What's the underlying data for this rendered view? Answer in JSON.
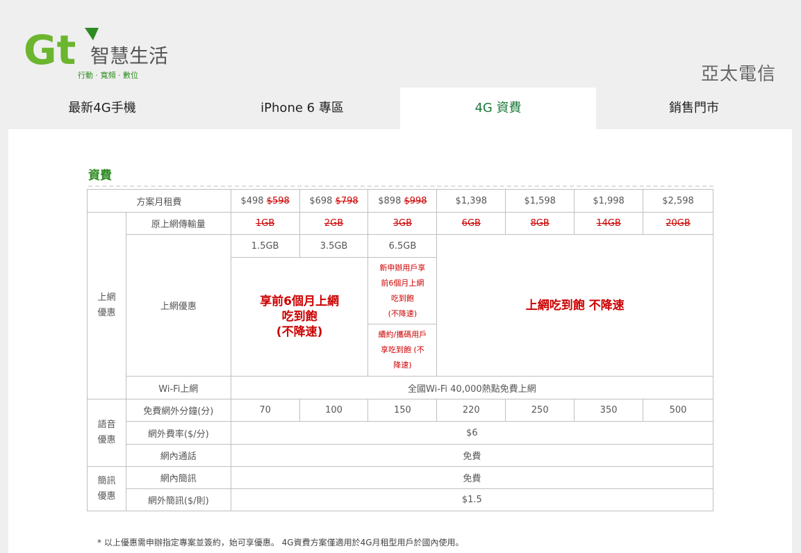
{
  "logo": {
    "mark": "Gt",
    "name": "智慧生活",
    "tagline": "行動 · 寬頻 · 數位"
  },
  "brand_right": "亞太電信",
  "colors": {
    "brand_green": "#6bb52f",
    "accent_green": "#2e8b22",
    "promo_red": "#cc0000"
  },
  "nav": [
    {
      "label": "最新4G手機"
    },
    {
      "label": "iPhone 6 專區"
    },
    {
      "label": "4G 資費",
      "active": true
    },
    {
      "label": "銷售門市"
    }
  ],
  "section_title": "資費",
  "table": {
    "row_monthly_label": "方案月租費",
    "prices": [
      {
        "price": "$498",
        "old": "$598"
      },
      {
        "price": "$698",
        "old": "$798"
      },
      {
        "price": "$898",
        "old": "$998"
      },
      {
        "price": "$1,398",
        "old": ""
      },
      {
        "price": "$1,598",
        "old": ""
      },
      {
        "price": "$1,998",
        "old": ""
      },
      {
        "price": "$2,598",
        "old": ""
      }
    ],
    "group_internet": "上網\n優惠",
    "row_orig_data_label": "原上網傳輸量",
    "orig_data": [
      "1GB",
      "2GB",
      "3GB",
      "6GB",
      "8GB",
      "14GB",
      "20GB"
    ],
    "row_internet_label": "上網優惠",
    "data_allowance": [
      "1.5GB",
      "3.5GB",
      "6.5GB"
    ],
    "promo_first6": "享前6個月上網\n吃到飽\n(不降速)",
    "promo_new_user": "新申辦用戶享\n前6個月上網\n吃到飽\n(不降速)",
    "promo_renew": "續約/攜碼用戶\n享吃到飽 (不\n降速)",
    "promo_unlimited": "上網吃到飽 不降速",
    "row_wifi_label": "Wi-Fi上網",
    "wifi_value": "全國Wi-Fi 40,000熱點免費上網",
    "group_voice": "語音\n優惠",
    "row_free_minutes_label": "免費網外分鐘(分)",
    "free_minutes": [
      "70",
      "100",
      "150",
      "220",
      "250",
      "350",
      "500"
    ],
    "row_offnet_rate_label": "網外費率($/分)",
    "offnet_rate": "$6",
    "row_onnet_call_label": "網內通話",
    "onnet_call": "免費",
    "group_sms": "簡訊\n優惠",
    "row_onnet_sms_label": "網內簡訊",
    "onnet_sms": "免費",
    "row_offnet_sms_label": "網外簡訊($/則)",
    "offnet_sms": "$1.5"
  },
  "footnote": "* 以上優惠需申辦指定專案並簽約，始可享優惠。 4G資費方案僅適用於4G月租型用戶於國內使用。"
}
